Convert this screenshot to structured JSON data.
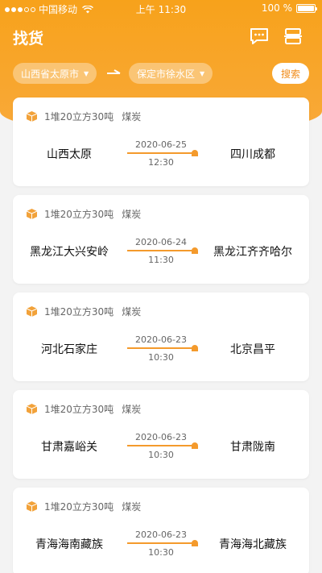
{
  "status": {
    "carrier": "中国移动",
    "time": "上午 11:30",
    "battery": "100 %"
  },
  "header": {
    "title": "找货"
  },
  "filter": {
    "from": "山西省太原市",
    "to": "保定市徐水区",
    "search_label": "搜索"
  },
  "cards": [
    {
      "cargo": "1堆20立方30吨",
      "type": "煤炭",
      "from": "山西太原",
      "to": "四川成都",
      "date": "2020-06-25",
      "time": "12:30"
    },
    {
      "cargo": "1堆20立方30吨",
      "type": "煤炭",
      "from": "黑龙江大兴安岭",
      "to": "黑龙江齐齐哈尔",
      "date": "2020-06-24",
      "time": "11:30"
    },
    {
      "cargo": "1堆20立方30吨",
      "type": "煤炭",
      "from": "河北石家庄",
      "to": "北京昌平",
      "date": "2020-06-23",
      "time": "10:30"
    },
    {
      "cargo": "1堆20立方30吨",
      "type": "煤炭",
      "from": "甘肃嘉峪关",
      "to": "甘肃陇南",
      "date": "2020-06-23",
      "time": "10:30"
    },
    {
      "cargo": "1堆20立方30吨",
      "type": "煤炭",
      "from": "青海海南藏族",
      "to": "青海海北藏族",
      "date": "2020-06-23",
      "time": "10:30"
    }
  ],
  "colors": {
    "accent": "#f7a21b",
    "route": "#f49a2c"
  },
  "icons": {
    "message": "chat-bubble-icon",
    "scan": "scan-icon",
    "cargo": "box-icon"
  }
}
